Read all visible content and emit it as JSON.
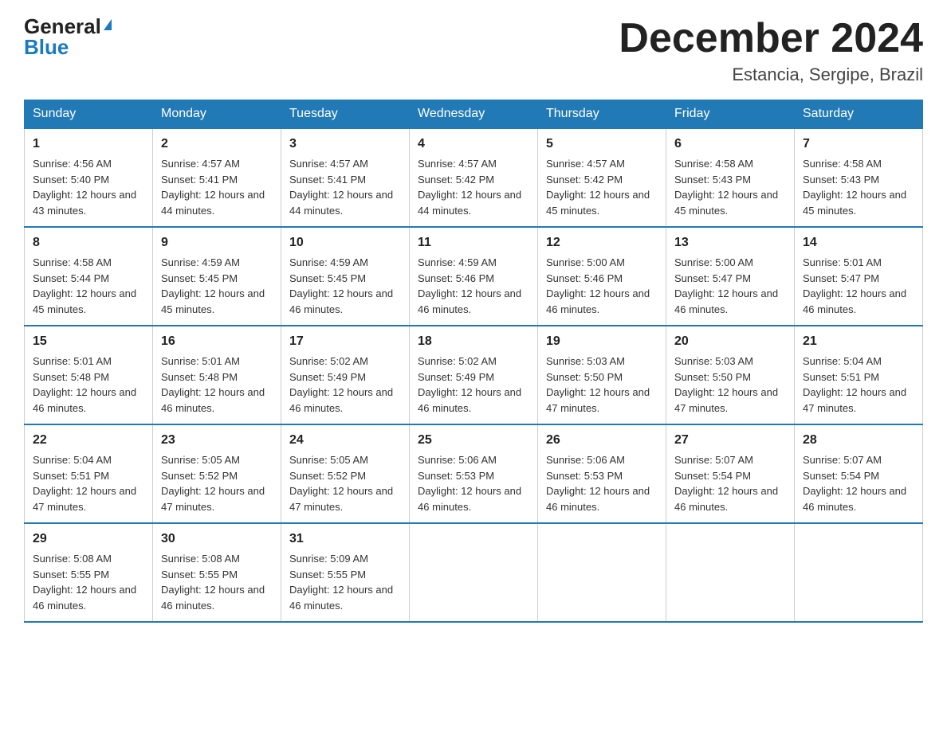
{
  "logo": {
    "general": "General",
    "blue": "Blue"
  },
  "title": {
    "month_year": "December 2024",
    "location": "Estancia, Sergipe, Brazil"
  },
  "weekdays": [
    "Sunday",
    "Monday",
    "Tuesday",
    "Wednesday",
    "Thursday",
    "Friday",
    "Saturday"
  ],
  "weeks": [
    [
      {
        "day": "1",
        "sunrise": "4:56 AM",
        "sunset": "5:40 PM",
        "daylight": "12 hours and 43 minutes."
      },
      {
        "day": "2",
        "sunrise": "4:57 AM",
        "sunset": "5:41 PM",
        "daylight": "12 hours and 44 minutes."
      },
      {
        "day": "3",
        "sunrise": "4:57 AM",
        "sunset": "5:41 PM",
        "daylight": "12 hours and 44 minutes."
      },
      {
        "day": "4",
        "sunrise": "4:57 AM",
        "sunset": "5:42 PM",
        "daylight": "12 hours and 44 minutes."
      },
      {
        "day": "5",
        "sunrise": "4:57 AM",
        "sunset": "5:42 PM",
        "daylight": "12 hours and 45 minutes."
      },
      {
        "day": "6",
        "sunrise": "4:58 AM",
        "sunset": "5:43 PM",
        "daylight": "12 hours and 45 minutes."
      },
      {
        "day": "7",
        "sunrise": "4:58 AM",
        "sunset": "5:43 PM",
        "daylight": "12 hours and 45 minutes."
      }
    ],
    [
      {
        "day": "8",
        "sunrise": "4:58 AM",
        "sunset": "5:44 PM",
        "daylight": "12 hours and 45 minutes."
      },
      {
        "day": "9",
        "sunrise": "4:59 AM",
        "sunset": "5:45 PM",
        "daylight": "12 hours and 45 minutes."
      },
      {
        "day": "10",
        "sunrise": "4:59 AM",
        "sunset": "5:45 PM",
        "daylight": "12 hours and 46 minutes."
      },
      {
        "day": "11",
        "sunrise": "4:59 AM",
        "sunset": "5:46 PM",
        "daylight": "12 hours and 46 minutes."
      },
      {
        "day": "12",
        "sunrise": "5:00 AM",
        "sunset": "5:46 PM",
        "daylight": "12 hours and 46 minutes."
      },
      {
        "day": "13",
        "sunrise": "5:00 AM",
        "sunset": "5:47 PM",
        "daylight": "12 hours and 46 minutes."
      },
      {
        "day": "14",
        "sunrise": "5:01 AM",
        "sunset": "5:47 PM",
        "daylight": "12 hours and 46 minutes."
      }
    ],
    [
      {
        "day": "15",
        "sunrise": "5:01 AM",
        "sunset": "5:48 PM",
        "daylight": "12 hours and 46 minutes."
      },
      {
        "day": "16",
        "sunrise": "5:01 AM",
        "sunset": "5:48 PM",
        "daylight": "12 hours and 46 minutes."
      },
      {
        "day": "17",
        "sunrise": "5:02 AM",
        "sunset": "5:49 PM",
        "daylight": "12 hours and 46 minutes."
      },
      {
        "day": "18",
        "sunrise": "5:02 AM",
        "sunset": "5:49 PM",
        "daylight": "12 hours and 46 minutes."
      },
      {
        "day": "19",
        "sunrise": "5:03 AM",
        "sunset": "5:50 PM",
        "daylight": "12 hours and 47 minutes."
      },
      {
        "day": "20",
        "sunrise": "5:03 AM",
        "sunset": "5:50 PM",
        "daylight": "12 hours and 47 minutes."
      },
      {
        "day": "21",
        "sunrise": "5:04 AM",
        "sunset": "5:51 PM",
        "daylight": "12 hours and 47 minutes."
      }
    ],
    [
      {
        "day": "22",
        "sunrise": "5:04 AM",
        "sunset": "5:51 PM",
        "daylight": "12 hours and 47 minutes."
      },
      {
        "day": "23",
        "sunrise": "5:05 AM",
        "sunset": "5:52 PM",
        "daylight": "12 hours and 47 minutes."
      },
      {
        "day": "24",
        "sunrise": "5:05 AM",
        "sunset": "5:52 PM",
        "daylight": "12 hours and 47 minutes."
      },
      {
        "day": "25",
        "sunrise": "5:06 AM",
        "sunset": "5:53 PM",
        "daylight": "12 hours and 46 minutes."
      },
      {
        "day": "26",
        "sunrise": "5:06 AM",
        "sunset": "5:53 PM",
        "daylight": "12 hours and 46 minutes."
      },
      {
        "day": "27",
        "sunrise": "5:07 AM",
        "sunset": "5:54 PM",
        "daylight": "12 hours and 46 minutes."
      },
      {
        "day": "28",
        "sunrise": "5:07 AM",
        "sunset": "5:54 PM",
        "daylight": "12 hours and 46 minutes."
      }
    ],
    [
      {
        "day": "29",
        "sunrise": "5:08 AM",
        "sunset": "5:55 PM",
        "daylight": "12 hours and 46 minutes."
      },
      {
        "day": "30",
        "sunrise": "5:08 AM",
        "sunset": "5:55 PM",
        "daylight": "12 hours and 46 minutes."
      },
      {
        "day": "31",
        "sunrise": "5:09 AM",
        "sunset": "5:55 PM",
        "daylight": "12 hours and 46 minutes."
      },
      null,
      null,
      null,
      null
    ]
  ],
  "labels": {
    "sunrise": "Sunrise:",
    "sunset": "Sunset:",
    "daylight": "Daylight:"
  }
}
